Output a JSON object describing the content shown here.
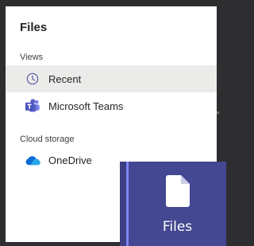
{
  "panel": {
    "title": "Files",
    "sections": [
      {
        "label": "Views",
        "items": [
          {
            "label": "Recent",
            "icon": "clock-icon",
            "selected": true
          },
          {
            "label": "Microsoft Teams",
            "icon": "teams-icon",
            "selected": false
          }
        ]
      },
      {
        "label": "Cloud storage",
        "items": [
          {
            "label": "OneDrive",
            "icon": "onedrive-icon",
            "selected": false
          }
        ]
      }
    ]
  },
  "app_bar": {
    "label": "Files",
    "icon": "file-icon"
  },
  "colors": {
    "accent": "#444791",
    "teams_purple": "#5b5fc7",
    "onedrive_blue": "#0078d4",
    "selected_bg": "#ebebe9"
  }
}
